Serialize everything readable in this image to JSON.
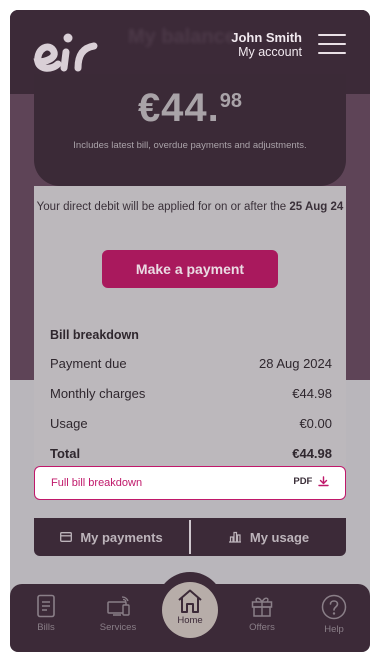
{
  "header": {
    "ghost_title": "My balance",
    "user_name": "John Smith",
    "account_link": "My account"
  },
  "balance": {
    "amount_main": "€44.",
    "amount_cents": "98",
    "note": "Includes latest bill, overdue payments and adjustments."
  },
  "direct_debit": {
    "text": "Your direct debit will be applied for on or after the",
    "date": "25 Aug 24"
  },
  "make_payment_label": "Make a payment",
  "bill_breakdown": {
    "title": "Bill breakdown",
    "rows": [
      {
        "label": "Payment due",
        "value": "28 Aug 2024"
      },
      {
        "label": "Monthly charges",
        "value": "€44.98"
      },
      {
        "label": "Usage",
        "value": "€0.00"
      },
      {
        "label": "Total",
        "value": "€44.98"
      }
    ]
  },
  "full_bill": {
    "label": "Full bill breakdown",
    "format": "PDF"
  },
  "buttons": {
    "my_payments": "My payments",
    "my_usage": "My usage"
  },
  "nav": {
    "bills": "Bills",
    "services": "Services",
    "home": "Home",
    "offers": "Offers",
    "help": "Help"
  },
  "colors": {
    "brand_header": "#3c2a38",
    "accent": "#a9195d",
    "link": "#c0186a"
  }
}
